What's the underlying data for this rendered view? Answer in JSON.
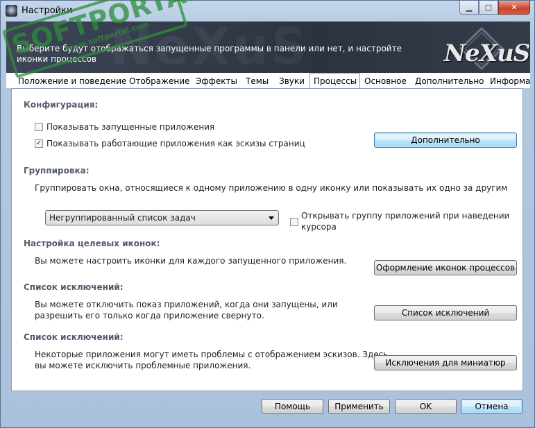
{
  "window": {
    "title": "Настройки"
  },
  "header": {
    "description": "Выберите будут отображаться запущенные программы в панели или нет, и настройте иконки процессов",
    "logo_text": "NeXuS"
  },
  "watermark": {
    "main": "SOFTPORTAL",
    "url": "www.softportal.com",
    "tm": "TM"
  },
  "tabs": [
    {
      "label": "Положение и поведение"
    },
    {
      "label": "Отображение"
    },
    {
      "label": "Эффекты"
    },
    {
      "label": "Темы"
    },
    {
      "label": "Звуки"
    },
    {
      "label": "Процессы",
      "active": true
    },
    {
      "label": "Основное"
    },
    {
      "label": "Дополнительно"
    },
    {
      "label": "Информац"
    }
  ],
  "config": {
    "title": "Конфигурация:",
    "show_running_label": "Показывать запущенные приложения",
    "show_running_checked": false,
    "show_thumbnails_label": "Показывать работающие приложения как эскизы страниц",
    "show_thumbnails_checked": true,
    "advanced_button": "Дополнительно"
  },
  "grouping": {
    "title": "Группировка:",
    "description": "Группировать окна, относящиеся к одному приложению в одну иконку или показывать их одно за другим",
    "select_value": "Негруппированный список задач",
    "open_group_label_1": "Открывать группу приложений при наведении",
    "open_group_label_2": "курсора",
    "open_group_checked": false
  },
  "target_icons": {
    "title": "Настройка целевых иконок:",
    "description": "Вы можете настроить иконки для каждого запущенного приложения.",
    "button": "Оформление иконок процессов"
  },
  "exclusions": {
    "title": "Список исключений:",
    "description_1": "Вы можете отключить показ приложений, когда они запущены, или",
    "description_2": "разрешить его только когда приложение свернуто.",
    "button": "Список исключений"
  },
  "thumb_exclusions": {
    "title": "Список исключений:",
    "description_1": "Некоторые приложения могут иметь проблемы с отображением эскизов. Здесь",
    "description_2": "вы можете исключить проблемные приложения.",
    "button": "Исключения для миниатюр"
  },
  "footer": {
    "help": "Помощь",
    "apply": "Применить",
    "ok": "OK",
    "cancel": "Отмена"
  },
  "icons": {
    "app": "nexus-app-icon",
    "checkbox_mark": "✓",
    "minimize": "minimize-icon",
    "maximize": "maximize-icon",
    "close": "close-icon"
  }
}
